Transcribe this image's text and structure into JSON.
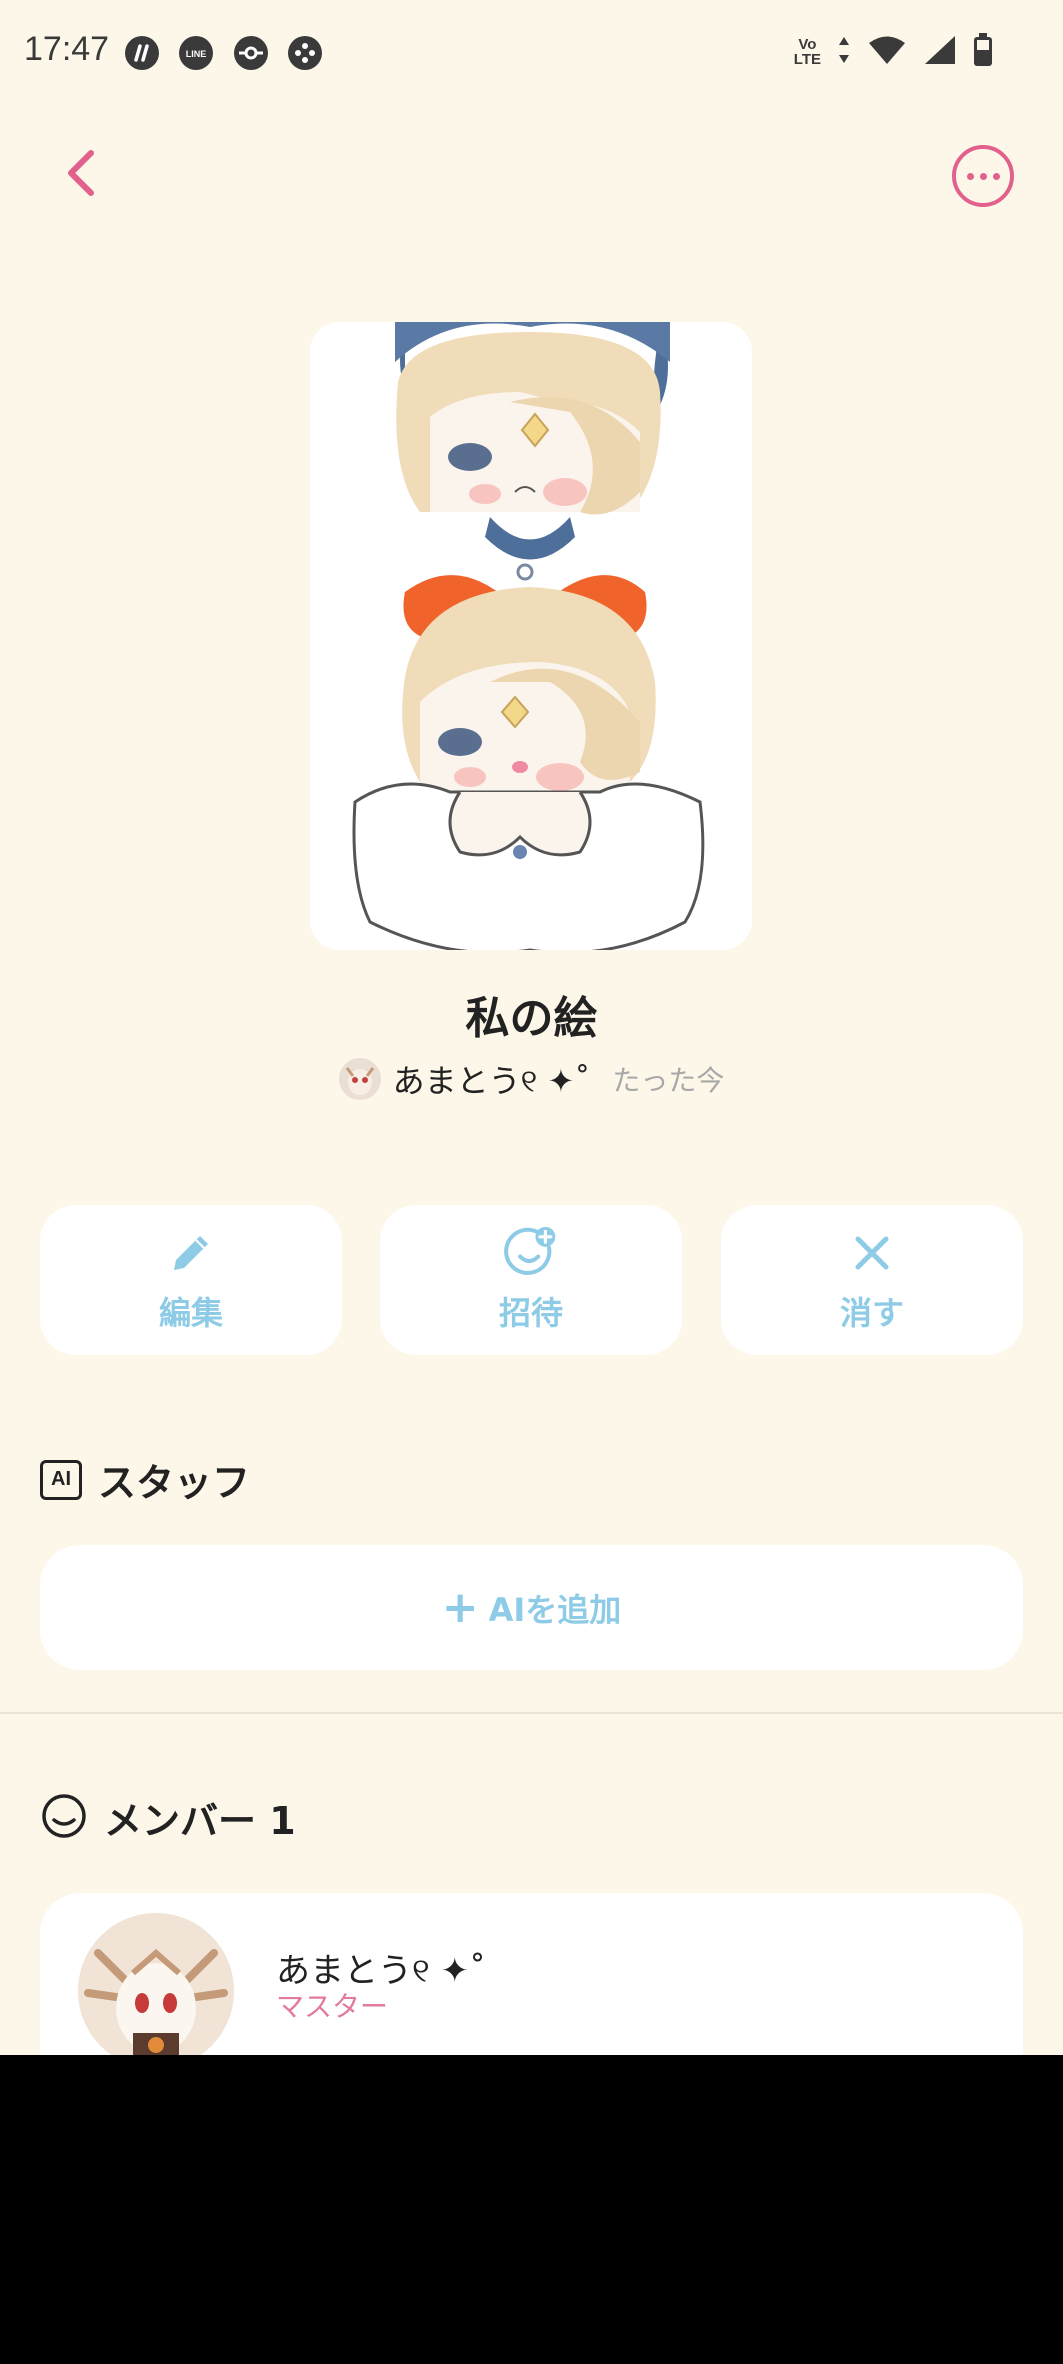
{
  "status_bar": {
    "time": "17:47",
    "app_icons": [
      "notification-app-icon",
      "line-app-icon",
      "pokeball-icon",
      "game-controller-icon"
    ],
    "network_label_top": "Vo",
    "network_label_bottom": "LTE"
  },
  "header": {
    "back_icon": "chevron-left-icon",
    "more_icon": "more-horizontal-icon",
    "accent_color": "#e2608c"
  },
  "project": {
    "title": "私の絵",
    "owner_name": "あまとう୧ ✦˚",
    "timestamp": "たった今"
  },
  "actions": [
    {
      "label": "編集",
      "icon": "pencil-icon"
    },
    {
      "label": "招待",
      "icon": "invite-smile-plus-icon"
    },
    {
      "label": "消す",
      "icon": "close-x-icon"
    }
  ],
  "action_color": "#8ecbe6",
  "staff": {
    "title": "スタッフ",
    "badge": "AI",
    "add_label": "AIを追加"
  },
  "members": {
    "title": "メンバー",
    "count": "1",
    "items": [
      {
        "name": "あまとう୧ ✦˚",
        "role": "マスター"
      }
    ]
  }
}
